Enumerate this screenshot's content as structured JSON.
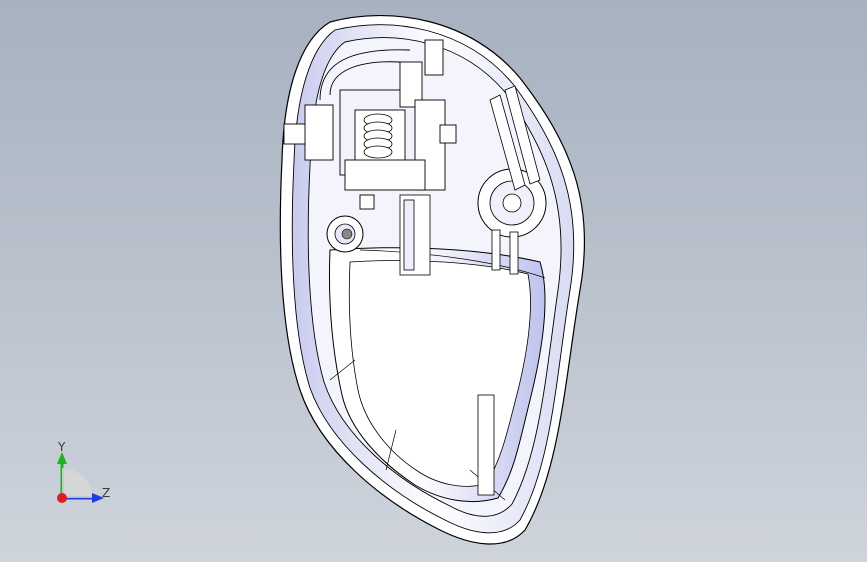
{
  "viewport": {
    "background_top": "#a7b1c0",
    "background_bottom": "#cfd4dc"
  },
  "model": {
    "edge_color": "#000000",
    "face_color": "#ffffff",
    "shade_color": "#cfd1f0"
  },
  "triad": {
    "y_label": "Y",
    "z_label": "Z",
    "y_color": "#1fb31f",
    "z_color": "#1f3ddb",
    "x_color": "#d81e1e"
  }
}
